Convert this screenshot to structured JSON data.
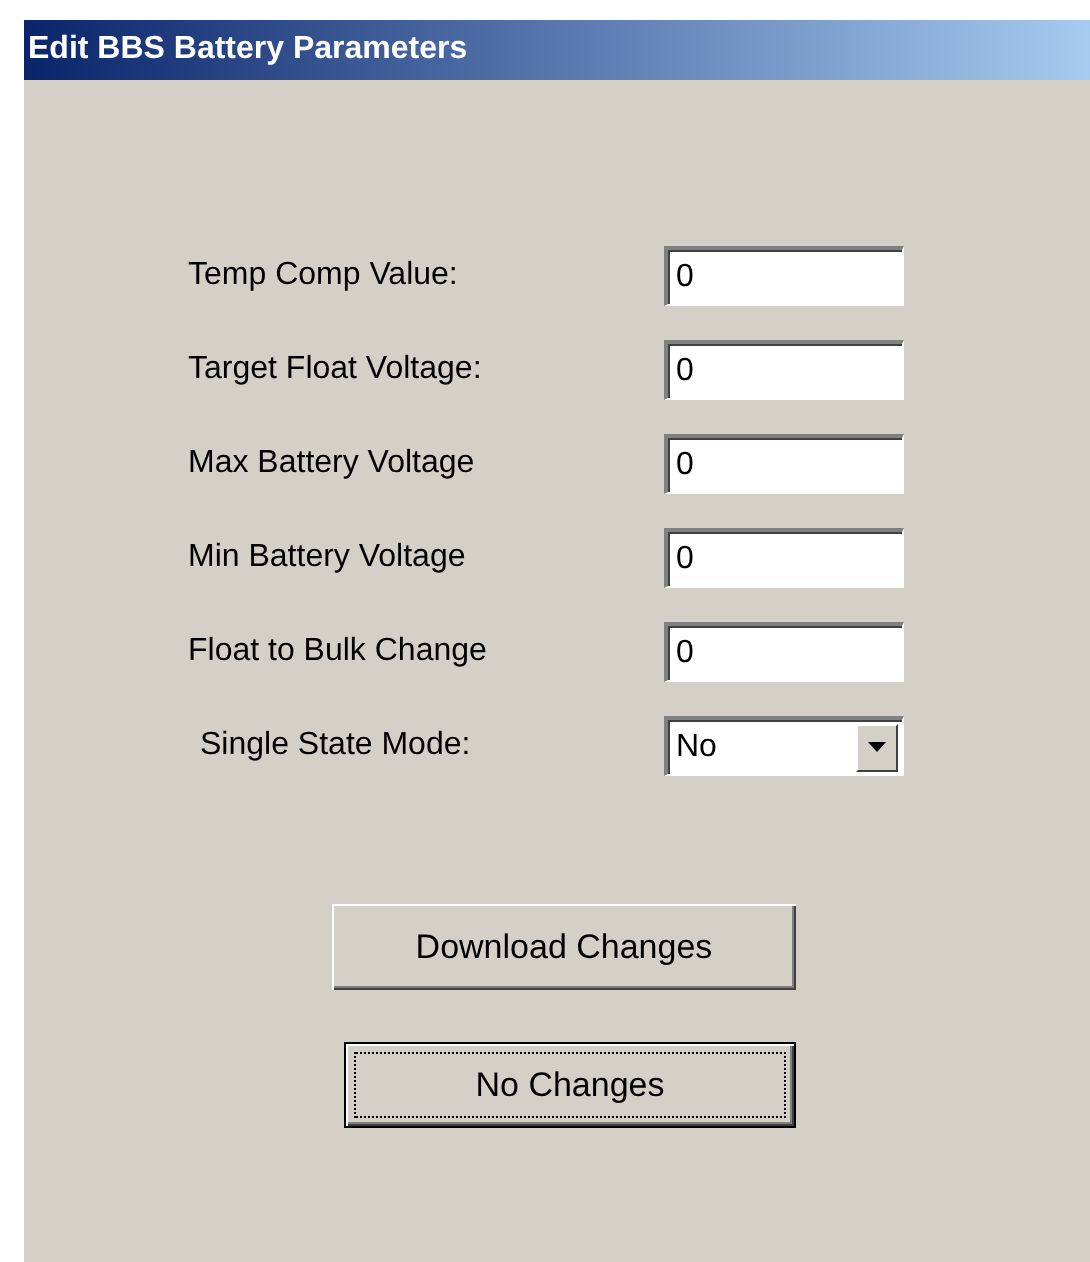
{
  "window": {
    "title": "Edit BBS Battery Parameters"
  },
  "fields": [
    {
      "kind": "text",
      "label": "Temp Comp Value:",
      "value": "0"
    },
    {
      "kind": "text",
      "label": "Target Float Voltage:",
      "value": "0"
    },
    {
      "kind": "text",
      "label": "Max Battery Voltage",
      "value": "0"
    },
    {
      "kind": "text",
      "label": "Min Battery Voltage",
      "value": "0"
    },
    {
      "kind": "text",
      "label": "Float to Bulk Change",
      "value": "0"
    },
    {
      "kind": "dropdown",
      "label": "Single State Mode:",
      "value": "No"
    }
  ],
  "buttons": [
    {
      "label": "Download Changes",
      "focused": false
    },
    {
      "label": "No Changes",
      "focused": true
    }
  ]
}
